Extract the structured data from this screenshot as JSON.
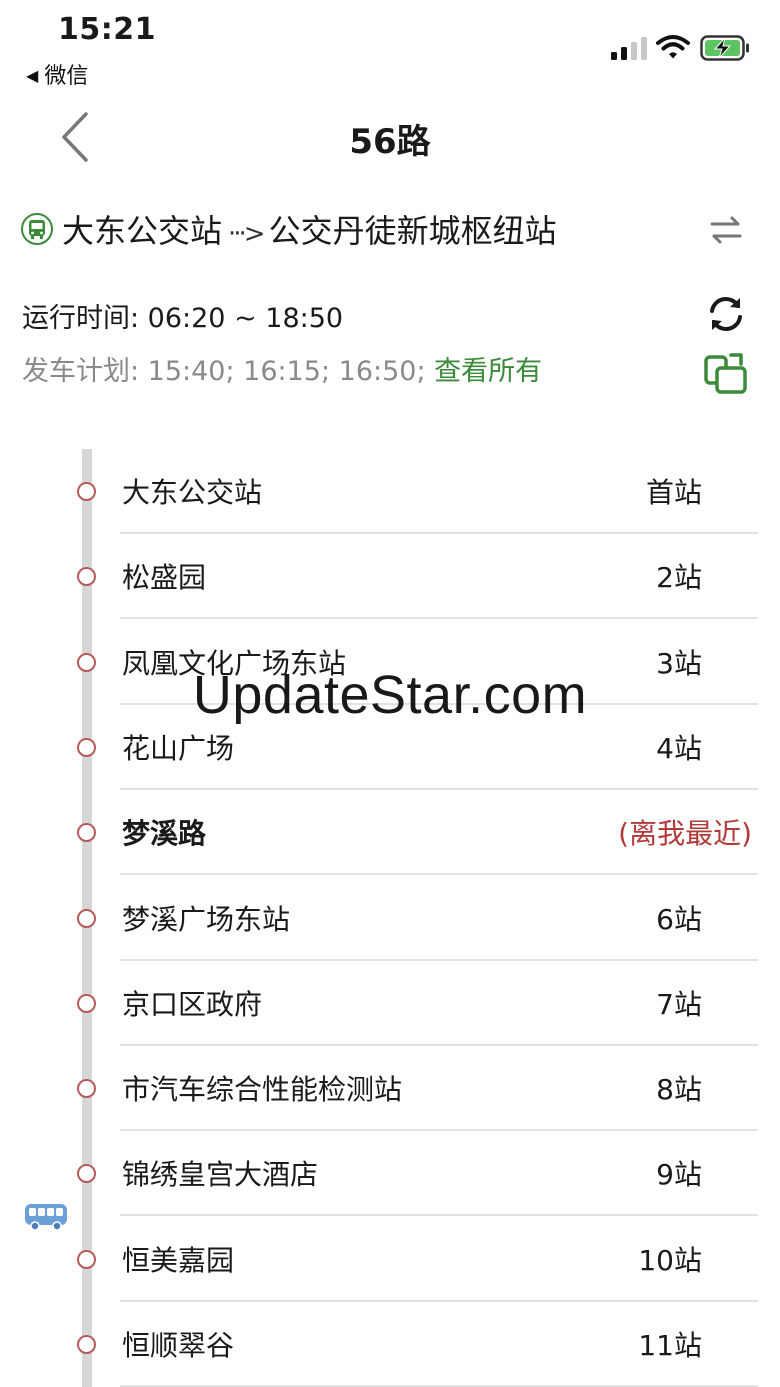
{
  "status_bar": {
    "time": "15:21",
    "back_app": "微信",
    "icons": [
      "cellular-signal-icon",
      "wifi-icon",
      "battery-charging-icon"
    ]
  },
  "nav": {
    "title": "56路",
    "back_icon": "chevron-left-icon"
  },
  "route": {
    "from": "大东公交站",
    "arrow": "···>",
    "to": "公交丹徒新城枢纽站",
    "bus_icon": "bus-stop-icon",
    "swap_icon": "swap-direction-icon"
  },
  "info": {
    "operating_time": "运行时间: 06:20 ~ 18:50",
    "plan_text": "发车计划: 15:40; 16:15; 16:50;",
    "see_all": "查看所有",
    "refresh_icon": "refresh-icon",
    "share_icon": "share-copy-icon"
  },
  "colors": {
    "accent_green": "#3a8a3a",
    "stop_dot": "#b55a5a",
    "nearest_red": "#b23a3a",
    "bus_blue": "#6a9fd8"
  },
  "stops": [
    {
      "name": "大东公交站",
      "count": "首站"
    },
    {
      "name": "松盛园",
      "count": "2站"
    },
    {
      "name": "凤凰文化广场东站",
      "count": "3站"
    },
    {
      "name": "花山广场",
      "count": "4站"
    },
    {
      "name": "梦溪路",
      "count": "(离我最近)",
      "nearest": true
    },
    {
      "name": "梦溪广场东站",
      "count": "6站"
    },
    {
      "name": "京口区政府",
      "count": "7站"
    },
    {
      "name": "市汽车综合性能检测站",
      "count": "8站"
    },
    {
      "name": "锦绣皇宫大酒店",
      "count": "9站"
    },
    {
      "name": "恒美嘉园",
      "count": "10站"
    },
    {
      "name": "恒顺翠谷",
      "count": "11站"
    }
  ],
  "bus_marker_icon": "bus-icon",
  "watermark": "UpdateStar.com"
}
